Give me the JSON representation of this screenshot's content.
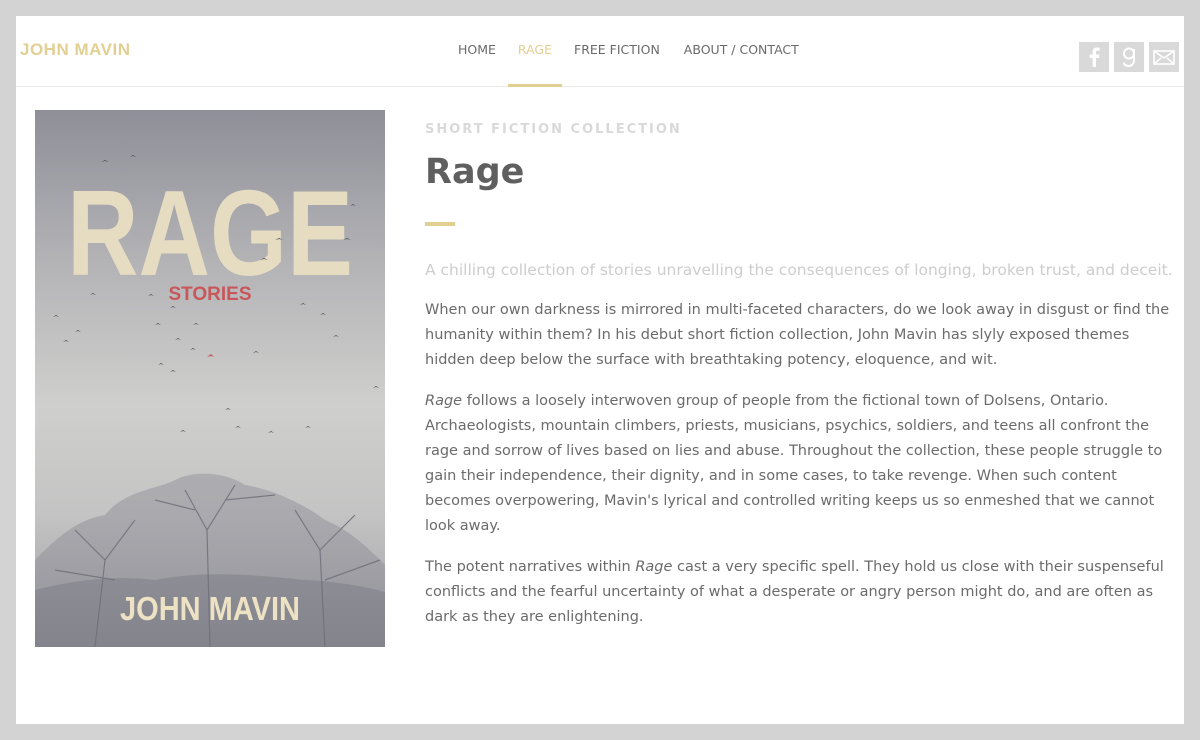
{
  "header": {
    "logo": "JOHN MAVIN",
    "nav": [
      {
        "label": "HOME",
        "active": false
      },
      {
        "label": "RAGE",
        "active": true
      },
      {
        "label": "FREE FICTION",
        "active": false
      },
      {
        "label": "ABOUT / CONTACT",
        "active": false
      }
    ],
    "social": [
      {
        "icon": "facebook-icon",
        "glyph": "f"
      },
      {
        "icon": "goodreads-icon",
        "glyph": "g"
      },
      {
        "icon": "email-icon",
        "glyph": "✉"
      }
    ]
  },
  "cover": {
    "title": "RAGE",
    "subtitle": "STORIES",
    "author": "JOHN MAVIN"
  },
  "book": {
    "kicker": "SHORT FICTION COLLECTION",
    "title": "Rage",
    "lead": "A chilling collection of stories unravelling the consequences of longing, broken trust, and deceit.",
    "para1": "When our own darkness is mirrored in multi-faceted characters, do we look away in disgust or find the humanity within them? In his debut short fiction collection, John Mavin has slyly exposed themes hidden deep below the surface with breathtaking potency, eloquence, and wit.",
    "para2_em": "Rage",
    "para2": " follows a loosely interwoven group of people from the fictional town of Dolsens, Ontario. Archaeologists, mountain climbers, priests, musicians, psychics, soldiers, and teens all confront the rage and sorrow of lives based on lies and abuse. Throughout the collection, these people struggle to gain their independence, their dignity, and in some cases, to take revenge. When such content becomes overpowering, Mavin's lyrical and controlled writing keeps us so enmeshed that we cannot look away.",
    "para3_a": "The potent narratives within ",
    "para3_em": "Rage",
    "para3_b": " cast a very specific spell. They hold us close with their suspenseful conflicts and the fearful uncertainty of what a desperate or angry person might do, and are often as dark as they are enlightening."
  },
  "colors": {
    "accent": "#e2cf92",
    "background": "#d3d3d3"
  }
}
